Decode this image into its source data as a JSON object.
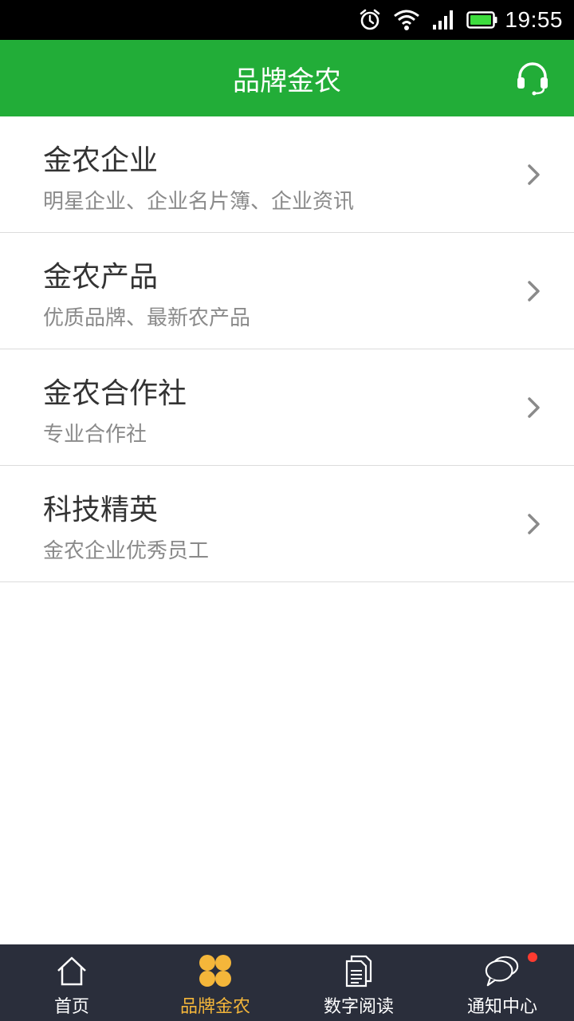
{
  "status_bar": {
    "time": "19:55",
    "icons": [
      "alarm-icon",
      "wifi-icon",
      "signal-icon",
      "battery-icon"
    ]
  },
  "header": {
    "title": "品牌金农",
    "right_icon": "headset-icon"
  },
  "list": {
    "items": [
      {
        "title": "金农企业",
        "subtitle": "明星企业、企业名片簿、企业资讯"
      },
      {
        "title": "金农产品",
        "subtitle": "优质品牌、最新农产品"
      },
      {
        "title": "金农合作社",
        "subtitle": "专业合作社"
      },
      {
        "title": "科技精英",
        "subtitle": "金农企业优秀员工"
      }
    ]
  },
  "bottom_nav": {
    "items": [
      {
        "label": "首页",
        "icon": "home-icon",
        "active": false
      },
      {
        "label": "品牌金农",
        "icon": "clover-icon",
        "active": true
      },
      {
        "label": "数字阅读",
        "icon": "documents-icon",
        "active": false
      },
      {
        "label": "通知中心",
        "icon": "chat-bubbles-icon",
        "active": false
      }
    ]
  },
  "colors": {
    "header_bg": "#22ad38",
    "nav_bg": "#2a2e3b",
    "nav_active": "#f4b63a",
    "badge": "#ff3b30"
  }
}
